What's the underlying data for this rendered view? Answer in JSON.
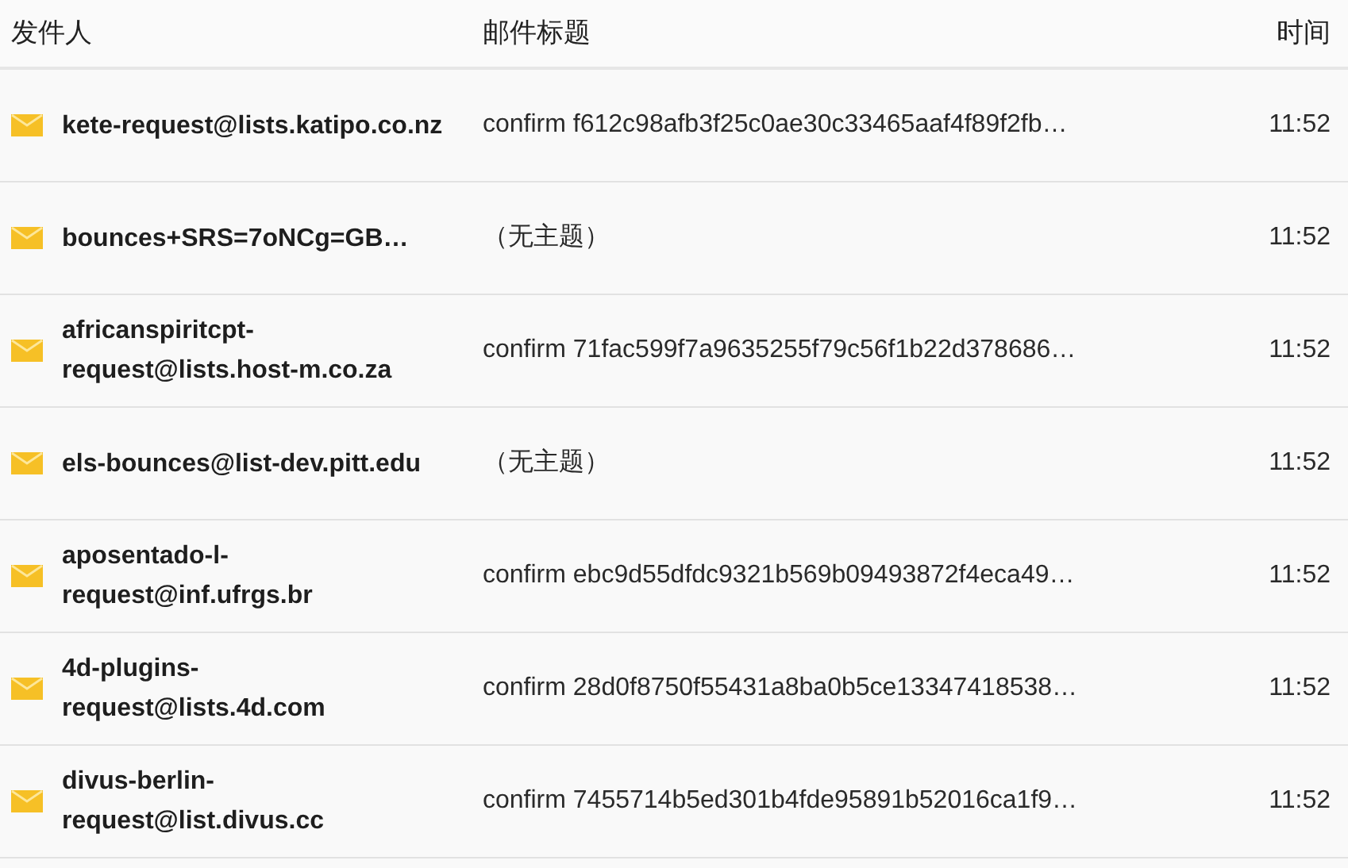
{
  "table": {
    "columns": [
      "发件人",
      "邮件标题",
      "时间"
    ],
    "rows": [
      {
        "sender": "kete-request@lists.katipo.co.nz",
        "subject": "confirm f612c98afb3f25c0ae30c33465aaf4f89f2fb…",
        "time": "11:52"
      },
      {
        "sender": "bounces+SRS=7oNCg=GB…",
        "subject": "（无主题）",
        "time": "11:52"
      },
      {
        "sender": "africanspiritcpt-request@lists.host-m.co.za",
        "subject": "confirm 71fac599f7a9635255f79c56f1b22d378686…",
        "time": "11:52"
      },
      {
        "sender": "els-bounces@list-dev.pitt.edu",
        "subject": "（无主题）",
        "time": "11:52"
      },
      {
        "sender": "aposentado-l-request@inf.ufrgs.br",
        "subject": "confirm ebc9d55dfdc9321b569b09493872f4eca49…",
        "time": "11:52"
      },
      {
        "sender": "4d-plugins-request@lists.4d.com",
        "subject": "confirm 28d0f8750f55431a8ba0b5ce13347418538…",
        "time": "11:52"
      },
      {
        "sender": "divus-berlin-request@list.divus.cc",
        "subject": "confirm 7455714b5ed301b4fde95891b52016ca1f9…",
        "time": "11:52"
      }
    ]
  }
}
